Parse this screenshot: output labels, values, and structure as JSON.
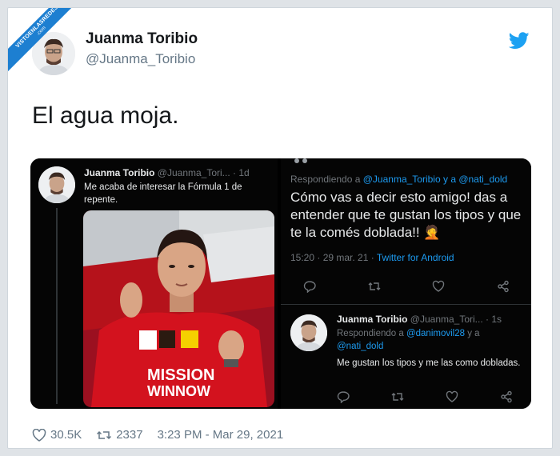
{
  "watermark": {
    "main": "VISTOENLASREDES",
    "sub": ".com"
  },
  "author": {
    "name": "Juanma Toribio",
    "handle": "@Juanma_Toribio"
  },
  "tweet": {
    "text": "El agua moja."
  },
  "screenshot_left": {
    "name": "Juanma Toribio",
    "handle_time": "@Juanma_Tori... · 1d",
    "body": "Me acaba de interesar la Fórmula 1 de repente."
  },
  "screenshot_right": {
    "reply_prefix": "Respondiendo a ",
    "reply_mentions": "@Juanma_Toribio y a @nati_dold",
    "body": "Cómo vas a decir esto amigo! das a entender que te gustan los tipos y que te la comés doblada!! 🤦",
    "timestamp": "15:20 · 29 mar. 21",
    "source": "Twitter for Android",
    "reply": {
      "name": "Juanma Toribio",
      "handle_time": "@Juanma_Tori... · 1s",
      "reply_prefix": "Respondiendo a ",
      "reply_mention_1": "@danimovil28",
      "reply_mid": " y a ",
      "reply_mention_2": "@nati_dold",
      "body": "Me gustan los tipos y me las como dobladas."
    }
  },
  "footer": {
    "likes": "30.5K",
    "retweets": "2337",
    "datetime": "3:23 PM - Mar 29, 2021"
  },
  "colors": {
    "twitter_blue": "#1da1f2",
    "ferrari_red": "#c8102e",
    "link_blue": "#1d9bf0"
  },
  "icons": [
    "twitter-bird-icon",
    "heart-icon",
    "retweet-icon",
    "reply-icon",
    "share-icon",
    "facepalm-emoji"
  ]
}
